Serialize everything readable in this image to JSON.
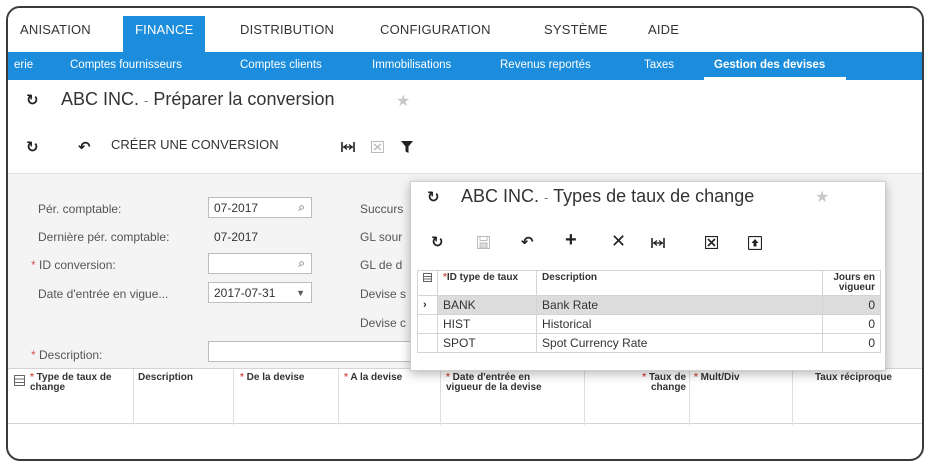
{
  "top_nav": {
    "items": [
      "ANISATION",
      "FINANCE",
      "DISTRIBUTION",
      "CONFIGURATION",
      "SYSTÈME",
      "AIDE"
    ],
    "active": "FINANCE"
  },
  "sub_nav": {
    "items": [
      "erie",
      "Comptes fournisseurs",
      "Comptes clients",
      "Immobilisations",
      "Revenus reportés",
      "Taxes",
      "Gestion des devises"
    ],
    "active": "Gestion des devises"
  },
  "page": {
    "company": "ABC INC.",
    "separator": "-",
    "title": "Préparer la conversion"
  },
  "toolbar": {
    "create_label": "CRÉER UNE CONVERSION"
  },
  "form": {
    "per_comptable_label": "Pér. comptable:",
    "per_comptable_value": "07-2017",
    "derniere_per_label": "Dernière pér. comptable:",
    "derniere_per_value": "07-2017",
    "id_conversion_label": "ID conversion:",
    "id_conversion_value": "",
    "date_entree_label": "Date d'entrée en vigue...",
    "date_entree_value": "2017-07-31",
    "description_label": "Description:",
    "right_labels": [
      "Succurs",
      "GL sour",
      "GL de d",
      "Devise s",
      "Devise c"
    ]
  },
  "grid_columns": [
    {
      "label": "Type de taux de change",
      "required": true
    },
    {
      "label": "Description",
      "required": false
    },
    {
      "label": "De la devise",
      "required": true
    },
    {
      "label": "A la devise",
      "required": true
    },
    {
      "label": "Date d'entrée en vigueur de la devise",
      "required": true
    },
    {
      "label": "Taux de change",
      "required": true
    },
    {
      "label": "Mult/Div",
      "required": true
    },
    {
      "label": "Taux réciproque",
      "required": false
    }
  ],
  "popup": {
    "company": "ABC INC.",
    "separator": "-",
    "title": "Types de taux de change",
    "headers": {
      "id": "ID type de taux",
      "description": "Description",
      "days": "Jours en vigueur"
    },
    "rows": [
      {
        "id": "BANK",
        "description": "Bank Rate",
        "days": "0"
      },
      {
        "id": "HIST",
        "description": "Historical",
        "days": "0"
      },
      {
        "id": "SPOT",
        "description": "Spot Currency Rate",
        "days": "0"
      }
    ],
    "selected_row": 0
  },
  "colors": {
    "accent": "#1c8ddc",
    "required": "#d9534f"
  }
}
